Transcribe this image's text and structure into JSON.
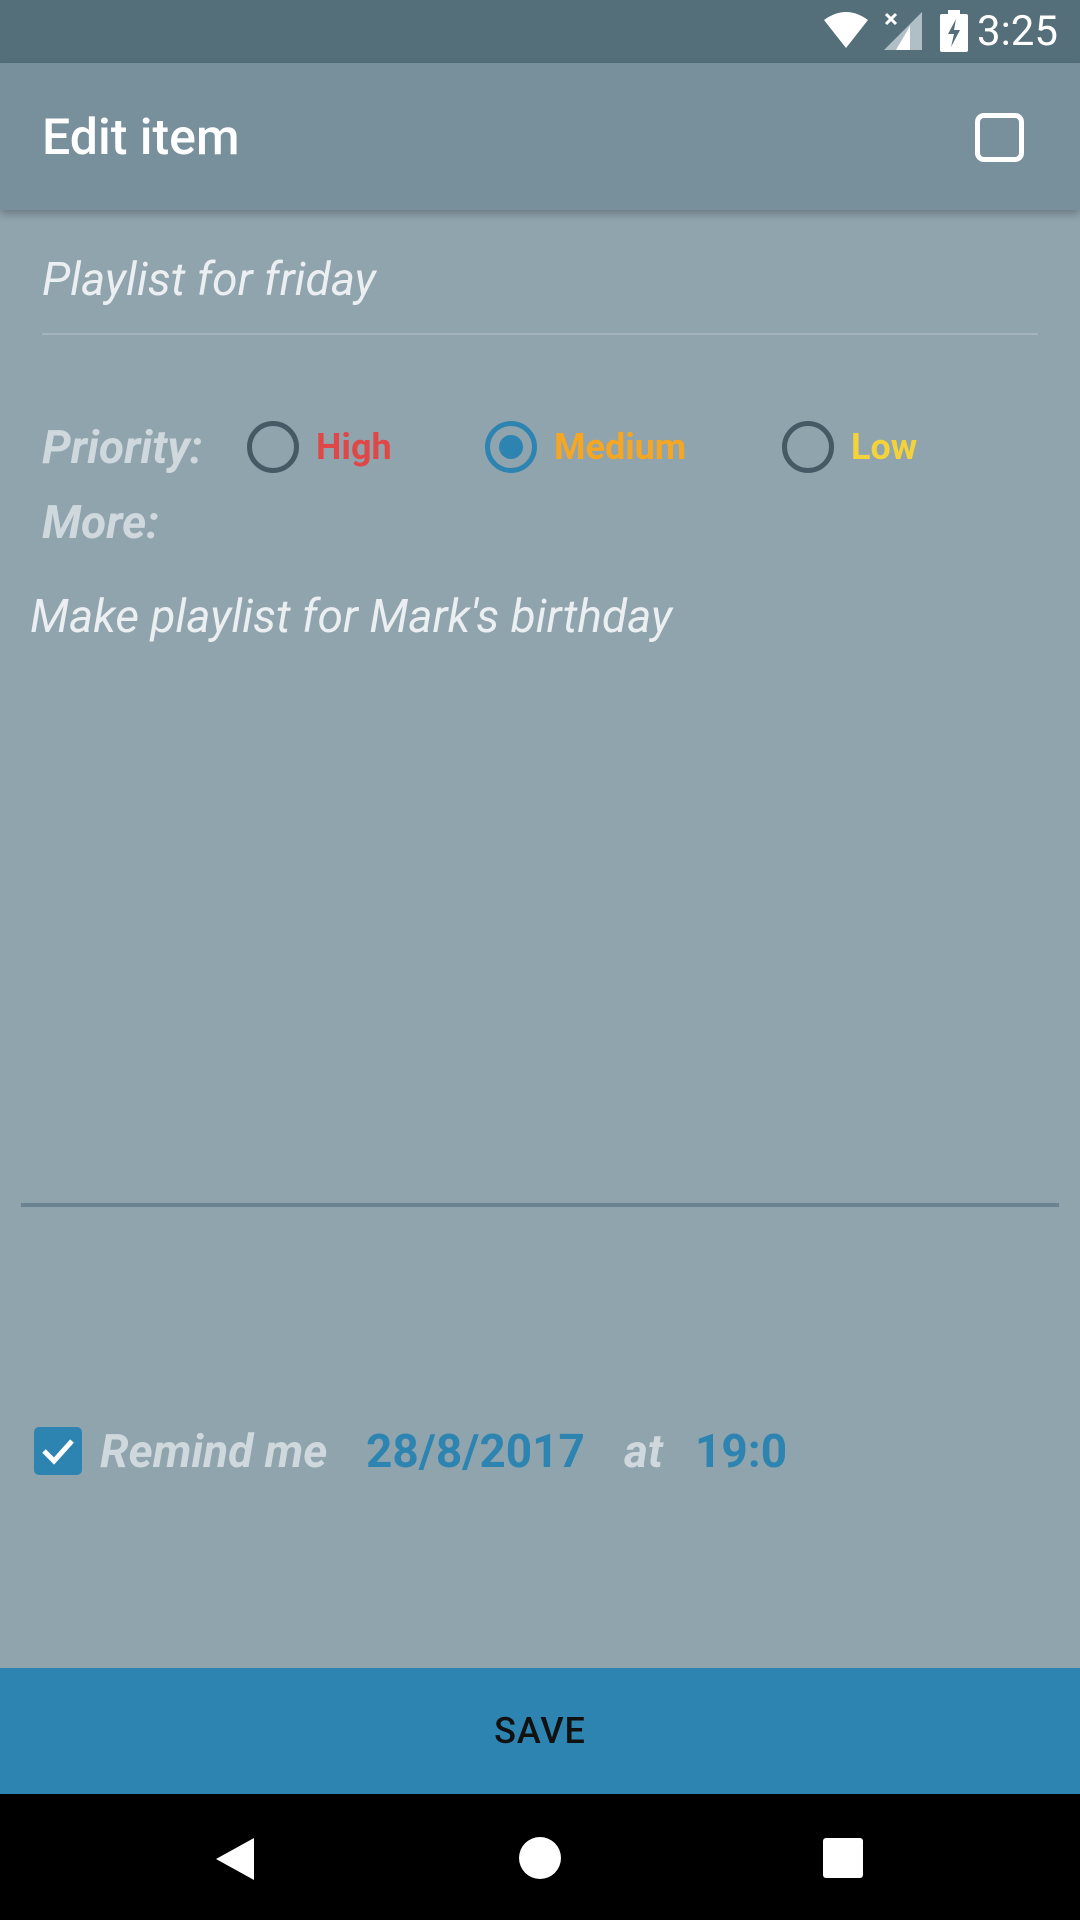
{
  "status_bar": {
    "time": "3:25",
    "icons": [
      "wifi-icon",
      "signal-icon",
      "battery-charging-icon"
    ]
  },
  "app_bar": {
    "title": "Edit item",
    "done_checked": false
  },
  "item": {
    "title_value": "Playlist for friday",
    "notes_value": "Make playlist for Mark's birthday"
  },
  "priority": {
    "label": "Priority:",
    "selected": "Medium",
    "options": [
      {
        "label": "High",
        "color": "#e04848",
        "checked": false
      },
      {
        "label": "Medium",
        "color": "#f5a623",
        "checked": true
      },
      {
        "label": "Low",
        "color": "#f4d33a",
        "checked": false
      }
    ]
  },
  "more": {
    "label": "More:"
  },
  "reminder": {
    "checked": true,
    "label": "Remind me",
    "date": "28/8/2017",
    "at_label": "at",
    "time": "19:0"
  },
  "actions": {
    "save_label": "SAVE"
  },
  "colors": {
    "accent": "#2e84b0",
    "background": "#90a4ae",
    "app_bar": "#78909c",
    "status_bar": "#546e7a"
  }
}
